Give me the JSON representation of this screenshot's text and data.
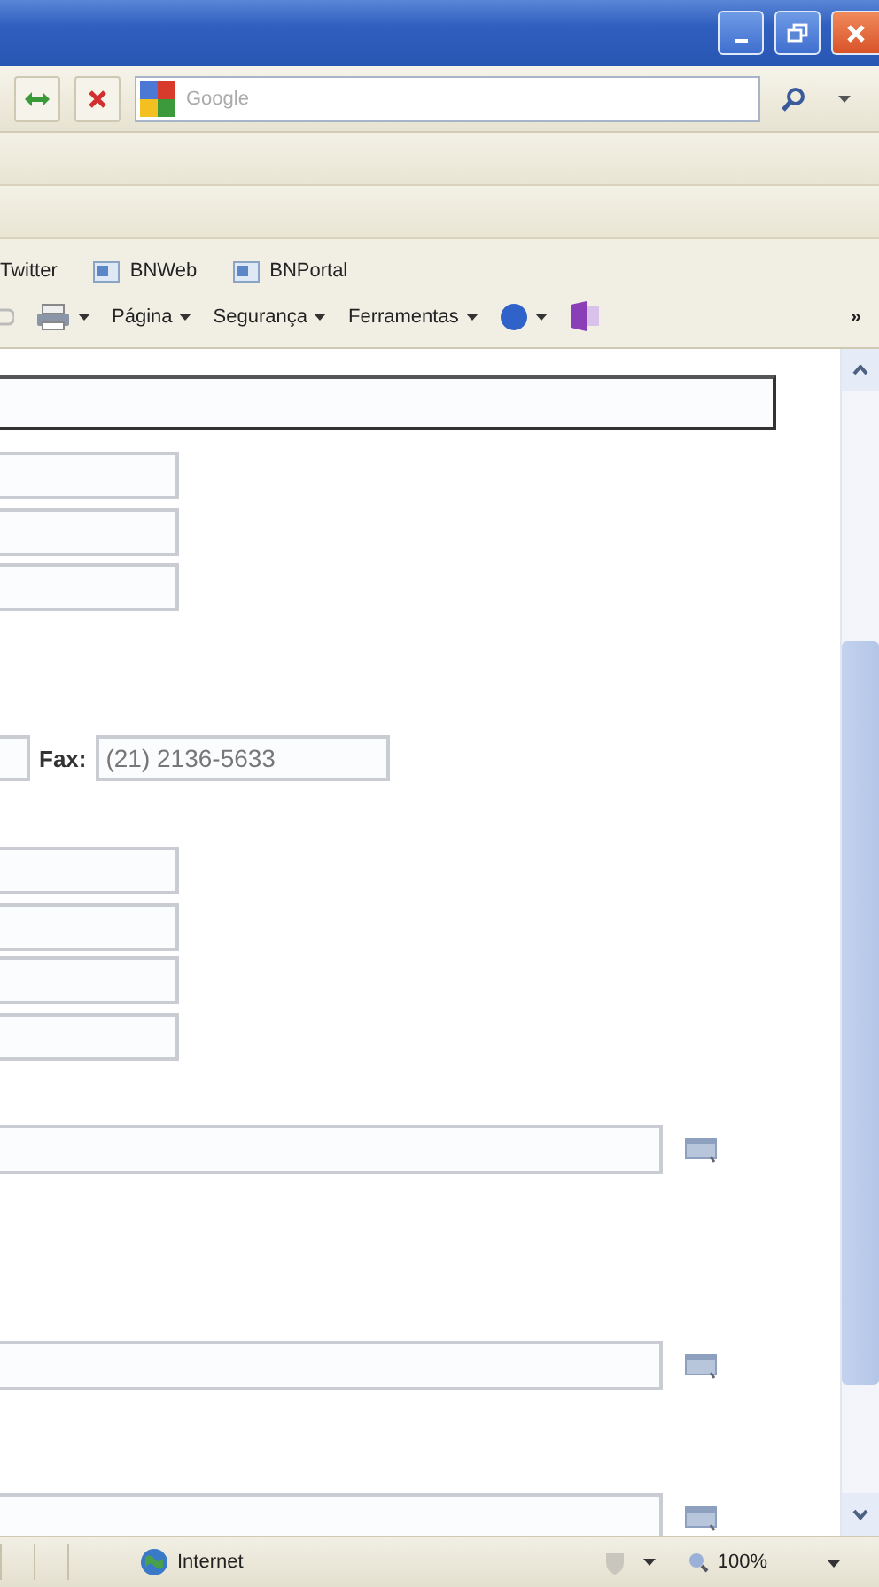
{
  "search": {
    "placeholder": "Google"
  },
  "favorites": [
    {
      "label": "Twitter"
    },
    {
      "label": "BNWeb"
    },
    {
      "label": "BNPortal"
    }
  ],
  "command_bar": {
    "menus": [
      {
        "label": "Página"
      },
      {
        "label": "Segurança"
      },
      {
        "label": "Ferramentas"
      }
    ],
    "overflow": "»"
  },
  "form": {
    "fields": [
      {
        "kind": "wide"
      },
      {
        "kind": "short"
      },
      {
        "kind": "short"
      },
      {
        "kind": "short"
      },
      {
        "kind": "fax",
        "label": "Fax:",
        "value": "(21) 2136-5633"
      },
      {
        "kind": "short"
      },
      {
        "kind": "short"
      },
      {
        "kind": "short"
      },
      {
        "kind": "short"
      },
      {
        "kind": "lookup"
      },
      {
        "kind": "lookup"
      },
      {
        "kind": "lookup"
      }
    ]
  },
  "status_bar": {
    "zone": "Internet",
    "zoom": "100%"
  }
}
